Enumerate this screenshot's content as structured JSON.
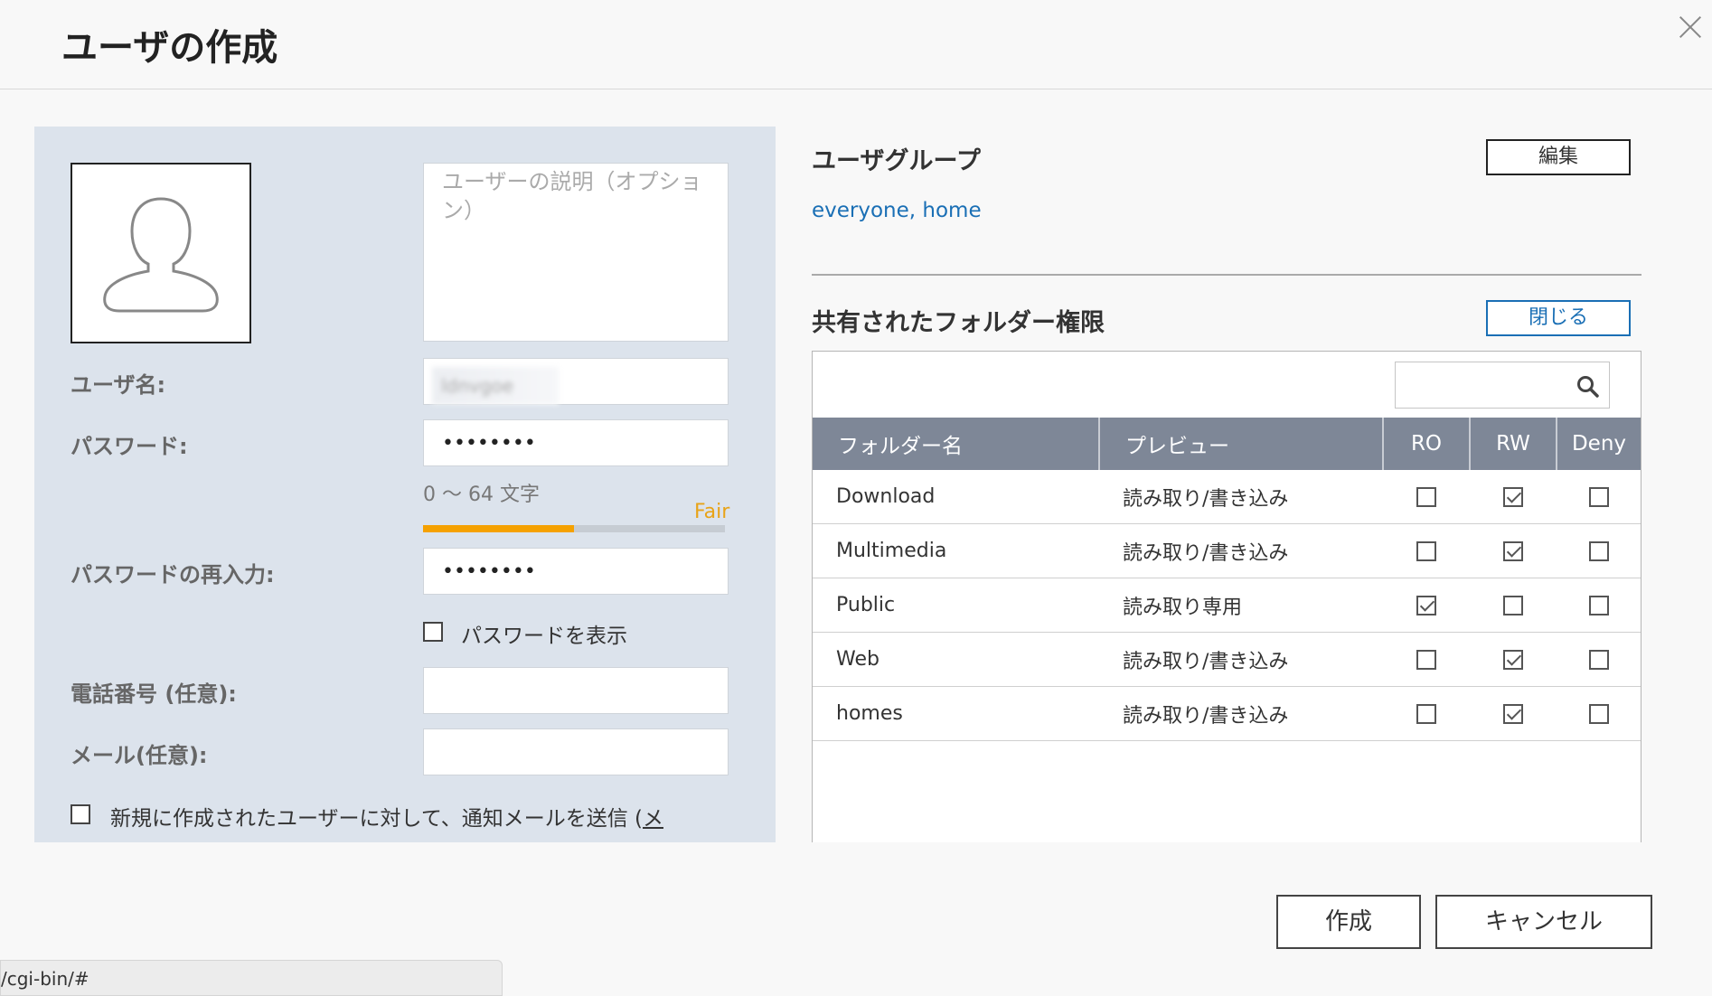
{
  "dialog": {
    "title": "ユーザの作成",
    "close_icon": "close-icon"
  },
  "left": {
    "description_placeholder": "ユーザーの説明（オプション）",
    "username_label": "ユーザ名:",
    "username_value": "ldnvgoe",
    "password_label": "パスワード:",
    "password_value": "••••••••",
    "password_hint": "0 ～ 64 文字",
    "strength_label": "Fair",
    "strength_level": 0.5,
    "password_confirm_label": "パスワードの再入力:",
    "password_confirm_value": "••••••••",
    "show_password_label": "パスワードを表示",
    "phone_label": "電話番号 (任意):",
    "email_label": "メール(任意):",
    "notify_label": "新規に作成されたユーザーに対して、通知メールを送信 (",
    "notify_link": "メ"
  },
  "right": {
    "group_title": "ユーザグループ",
    "edit_label": "編集",
    "groups": "everyone, home",
    "perm_title": "共有されたフォルダー権限",
    "close_label": "閉じる",
    "columns": {
      "folder": "フォルダー名",
      "preview": "プレビュー",
      "ro": "RO",
      "rw": "RW",
      "deny": "Deny"
    },
    "rows": [
      {
        "folder": "Download",
        "preview": "読み取り/書き込み",
        "type": "rw",
        "ro": false,
        "rw": true,
        "deny": false
      },
      {
        "folder": "Multimedia",
        "preview": "読み取り/書き込み",
        "type": "rw",
        "ro": false,
        "rw": true,
        "deny": false
      },
      {
        "folder": "Public",
        "preview": "読み取り専用",
        "type": "ro",
        "ro": true,
        "rw": false,
        "deny": false
      },
      {
        "folder": "Web",
        "preview": "読み取り/書き込み",
        "type": "rw",
        "ro": false,
        "rw": true,
        "deny": false
      },
      {
        "folder": "homes",
        "preview": "読み取り/書き込み",
        "type": "rw",
        "ro": false,
        "rw": true,
        "deny": false
      }
    ]
  },
  "footer": {
    "create_label": "作成",
    "cancel_label": "キャンセル"
  },
  "statusbar": {
    "url": "/cgi-bin/#"
  },
  "colors": {
    "panel_bg": "#dce3ec",
    "accent_blue": "#1a6fb5",
    "rw_green": "#2e9a2a",
    "ro_orange": "#e8a317",
    "table_header": "#7e8797"
  }
}
